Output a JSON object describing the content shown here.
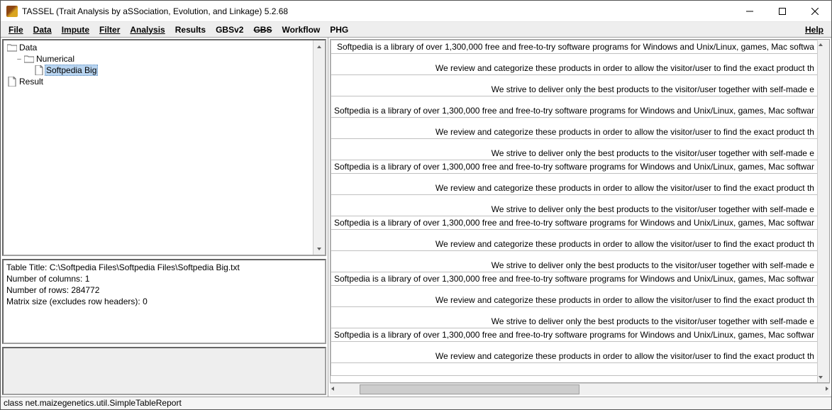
{
  "window": {
    "title": "TASSEL (Trait Analysis by aSSociation, Evolution, and Linkage) 5.2.68"
  },
  "menu": {
    "file": "File",
    "data": "Data",
    "impute": "Impute",
    "filter": "Filter",
    "analysis": "Analysis",
    "results": "Results",
    "gbsv2": "GBSv2",
    "gbs": "GBS",
    "workflow": "Workflow",
    "phg": "PHG",
    "help": "Help"
  },
  "tree": {
    "root": "Data",
    "numerical": "Numerical",
    "selected": "Softpedia Big",
    "result": "Result"
  },
  "info": {
    "line1": "Table Title: C:\\Softpedia Files\\Softpedia Files\\Softpedia Big.txt",
    "line2": "Number of columns: 1",
    "line3": "Number of rows: 284772",
    "line4": "Matrix size (excludes row headers): 0"
  },
  "table_rows": [
    {
      "tall": false,
      "text": "Softpedia is a library of over 1,300,000 free and free-to-try software programs for Windows and Unix/Linux, games, Mac softwa"
    },
    {
      "tall": true,
      "text": "We review and categorize these products in order to allow the visitor/user to find the exact product th"
    },
    {
      "tall": true,
      "text": "We strive to deliver only the best products to the visitor/user together with self-made e"
    },
    {
      "tall": true,
      "text": "Softpedia is a library of over 1,300,000 free and free-to-try software programs for Windows and Unix/Linux, games, Mac softwar"
    },
    {
      "tall": true,
      "text": "We review and categorize these products in order to allow the visitor/user to find the exact product th"
    },
    {
      "tall": true,
      "text": "We strive to deliver only the best products to the visitor/user together with self-made e"
    },
    {
      "tall": false,
      "text": "Softpedia is a library of over 1,300,000 free and free-to-try software programs for Windows and Unix/Linux, games, Mac softwar"
    },
    {
      "tall": true,
      "text": "We review and categorize these products in order to allow the visitor/user to find the exact product th"
    },
    {
      "tall": true,
      "text": "We strive to deliver only the best products to the visitor/user together with self-made e"
    },
    {
      "tall": false,
      "text": "Softpedia is a library of over 1,300,000 free and free-to-try software programs for Windows and Unix/Linux, games, Mac softwar"
    },
    {
      "tall": true,
      "text": "We review and categorize these products in order to allow the visitor/user to find the exact product th"
    },
    {
      "tall": true,
      "text": "We strive to deliver only the best products to the visitor/user together with self-made e"
    },
    {
      "tall": false,
      "text": "Softpedia is a library of over 1,300,000 free and free-to-try software programs for Windows and Unix/Linux, games, Mac softwar"
    },
    {
      "tall": true,
      "text": "We review and categorize these products in order to allow the visitor/user to find the exact product th"
    },
    {
      "tall": true,
      "text": "We strive to deliver only the best products to the visitor/user together with self-made e"
    },
    {
      "tall": false,
      "text": "Softpedia is a library of over 1,300,000 free and free-to-try software programs for Windows and Unix/Linux, games, Mac softwar"
    },
    {
      "tall": true,
      "text": "We review and categorize these products in order to allow the visitor/user to find the exact product th"
    },
    {
      "tall": false,
      "text": ""
    }
  ],
  "status": "class net.maizegenetics.util.SimpleTableReport"
}
